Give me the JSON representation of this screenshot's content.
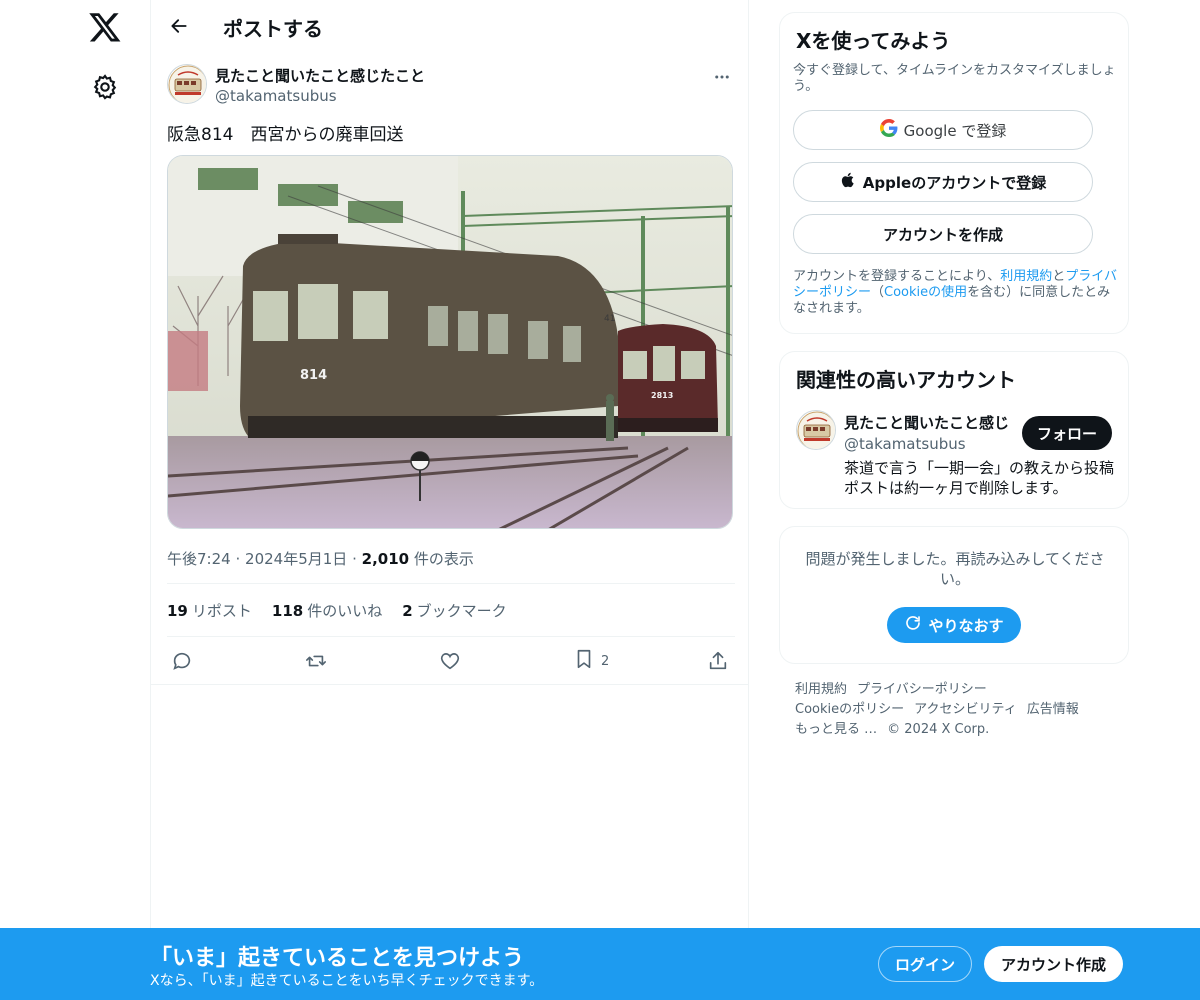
{
  "header": {
    "title": "ポストする"
  },
  "post": {
    "author_name": "見たこと聞いたこと感じたこと",
    "author_handle": "@takamatsubus",
    "text": "阪急814　西宮からの廃車回送",
    "photo_labels": {
      "car_left": "814",
      "car_right": "2813",
      "pole": "41"
    },
    "time": "午後7:24",
    "date": "2024年5月1日",
    "views_count": "2,010",
    "views_label": "件の表示",
    "sep": "·",
    "reposts_count": "19",
    "reposts_label": "リポスト",
    "likes_count": "118",
    "likes_label": "件のいいね",
    "bookmarks_count": "2",
    "bookmarks_label": "ブックマーク",
    "bookmark_action_count": "2"
  },
  "signup_card": {
    "title": "Xを使ってみよう",
    "subtitle": "今すぐ登録して、タイムラインをカスタマイズしましょう。",
    "google_label": "Google で登録",
    "apple_label": "Appleのアカウントで登録",
    "create_label": "アカウントを作成",
    "legal_pre": "アカウントを登録することにより、",
    "legal_terms": "利用規約",
    "legal_and": "と",
    "legal_privacy": "プライバシーポリシー",
    "legal_mid": "（",
    "legal_cookie": "Cookieの使用",
    "legal_post": "を含む）に同意したとみなされます。"
  },
  "related_card": {
    "title": "関連性の高いアカウント",
    "name": "見たこと聞いたこと感じ",
    "handle": "@takamatsubus",
    "follow_label": "フォロー",
    "bio": "茶道で言う「一期一会」の教えから投稿ポストは約一ヶ月で削除します。"
  },
  "error_card": {
    "message": "問題が発生しました。再読み込みしてください。",
    "retry_label": "やりなおす"
  },
  "footer": {
    "links": [
      "利用規約",
      "プライバシーポリシー",
      "Cookieのポリシー",
      "アクセシビリティ",
      "広告情報",
      "もっと見る …",
      "© 2024 X Corp."
    ]
  },
  "banner": {
    "title": "「いま」起きていることを見つけよう",
    "subtitle": "Xなら、「いま」起きていることをいち早くチェックできます。",
    "login_label": "ログイン",
    "signup_label": "アカウント作成"
  },
  "colors": {
    "accent": "#1d9bf0",
    "text": "#0f1419",
    "muted": "#536471",
    "border": "#eff3f4"
  },
  "icons": [
    "x-logo-icon",
    "gear-icon",
    "back-arrow-icon",
    "more-icon",
    "reply-icon",
    "repost-icon",
    "like-icon",
    "bookmark-icon",
    "share-icon",
    "google-icon",
    "apple-icon",
    "refresh-icon"
  ]
}
